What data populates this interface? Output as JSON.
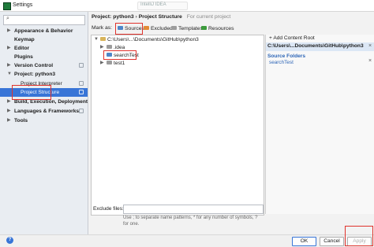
{
  "window": {
    "title": "Settings",
    "background_tab_text": "IntelliJ IDEA"
  },
  "sidebar": {
    "search_icon": "search-icon",
    "items": [
      {
        "label": "Appearance & Behavior",
        "arrow": "▶",
        "bold": true
      },
      {
        "label": "Keymap",
        "arrow": "",
        "bold": true
      },
      {
        "label": "Editor",
        "arrow": "▶",
        "bold": true
      },
      {
        "label": "Plugins",
        "arrow": "",
        "bold": true
      },
      {
        "label": "Version Control",
        "arrow": "▶",
        "bold": true
      },
      {
        "label": "Project: python3",
        "arrow": "▼",
        "bold": true
      },
      {
        "label": "Project Interpreter",
        "arrow": "",
        "bold": false
      },
      {
        "label": "Project Structure",
        "arrow": "",
        "bold": false,
        "selected": true
      },
      {
        "label": "Build, Execution, Deployment",
        "arrow": "▶",
        "bold": true
      },
      {
        "label": "Languages & Frameworks",
        "arrow": "▶",
        "bold": true
      },
      {
        "label": "Tools",
        "arrow": "▶",
        "bold": true
      }
    ]
  },
  "breadcrumb": {
    "project": "Project: python3",
    "separator": "›",
    "page": "Project Structure",
    "note": "For current project"
  },
  "mark_as": {
    "label": "Mark as:",
    "buttons": [
      {
        "label": "Sources",
        "color": "#4e86c8"
      },
      {
        "label": "Excluded",
        "color": "#e28a36"
      },
      {
        "label": "Templates",
        "color": "#9c9c9c"
      },
      {
        "label": "Resources",
        "color": "#3c9b3c"
      }
    ]
  },
  "file_tree": {
    "root": "C:\\Users\\...\\Documents\\GitHub\\python3",
    "children": [
      ".idea",
      "searchTest",
      "test1"
    ]
  },
  "exclude": {
    "label": "Exclude files:",
    "value": "",
    "hint": "Use ; to separate name patterns, * for any number of symbols, ? for one."
  },
  "content_root": {
    "add_label": "+ Add Content Root",
    "path": "C:\\Users\\...Documents\\GitHub\\python3",
    "source_title": "Source Folders",
    "source_items": [
      "searchTest"
    ],
    "close_glyph": "×"
  },
  "footer": {
    "help": "?",
    "ok": "OK",
    "cancel": "Cancel",
    "apply": "Apply"
  },
  "colors": {
    "selection": "#3875d7",
    "annotation": "#e0322c",
    "source_blue": "#2e66b7"
  }
}
